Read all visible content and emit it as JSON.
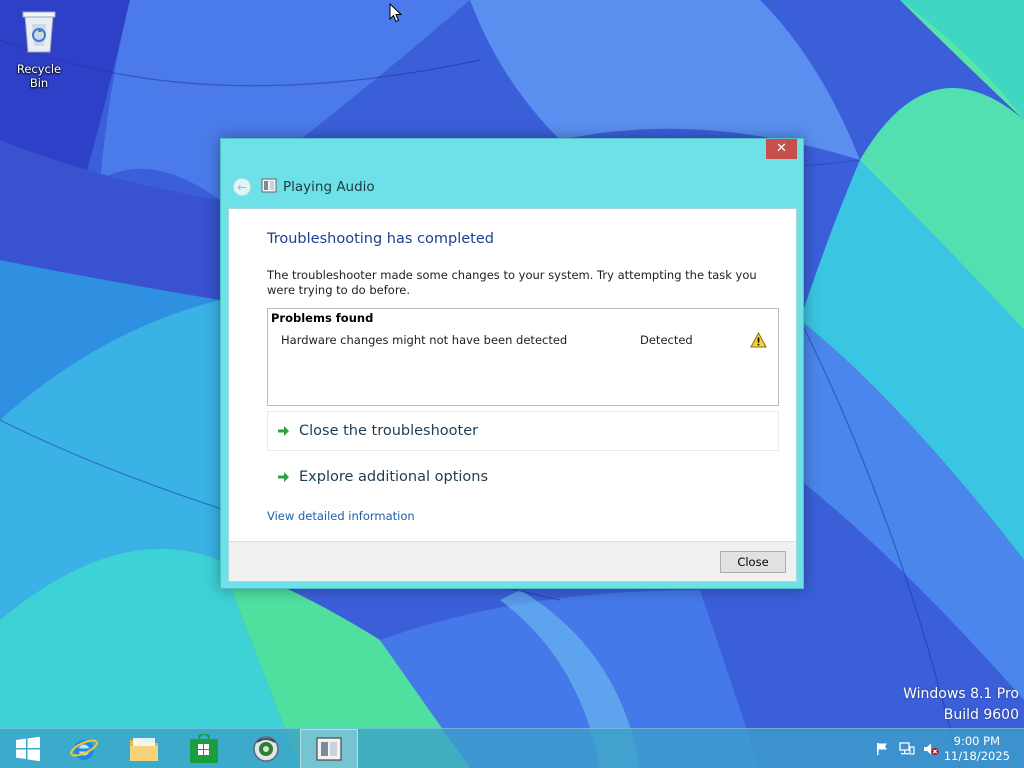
{
  "desktop": {
    "recycle_bin_label": "Recycle Bin",
    "watermark_line1": "Windows 8.1 Pro",
    "watermark_line2": "Build 9600"
  },
  "window": {
    "title": "Playing Audio",
    "close_glyph": "✕",
    "back_glyph": "←",
    "heading": "Troubleshooting has completed",
    "description": "The troubleshooter made some changes to your system. Try attempting the task you were trying to do before.",
    "problems": {
      "title": "Problems found",
      "items": [
        {
          "description": "Hardware changes might not have been detected",
          "status": "Detected",
          "icon": "warning-icon"
        }
      ]
    },
    "links": {
      "close_troubleshooter": "Close the troubleshooter",
      "explore_options": "Explore additional options",
      "view_details": "View detailed information"
    },
    "close_button": "Close"
  },
  "taskbar": {
    "apps": [
      "start-icon",
      "internet-explorer-icon",
      "file-explorer-icon",
      "store-icon",
      "media-center-icon",
      "troubleshooter-icon"
    ],
    "tray": [
      "flag-icon",
      "network-icon",
      "volume-muted-icon"
    ],
    "clock": {
      "time": "9:00 PM",
      "date": "11/18/2025"
    }
  },
  "colors": {
    "window_frame": "#6ee0e8",
    "close_button": "#c7504f",
    "heading": "#1c3f94",
    "link": "#1f5fa8",
    "taskbar": "#3ca0c8"
  }
}
